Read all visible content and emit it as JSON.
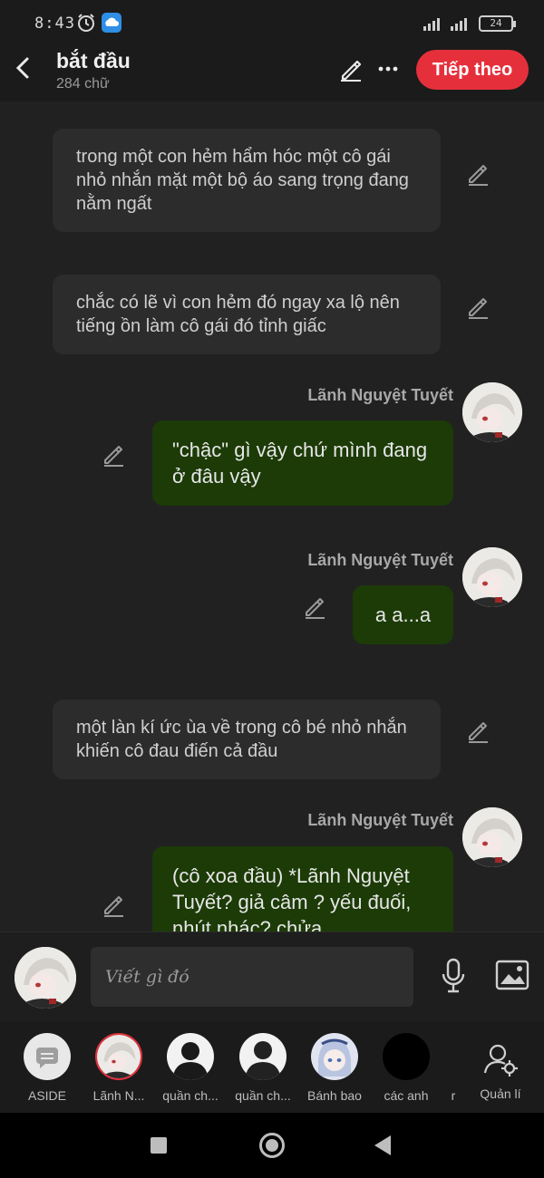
{
  "status": {
    "time": "8:43",
    "battery": "24"
  },
  "header": {
    "title": "bắt đầu",
    "subtitle": "284 chữ",
    "next_label": "Tiếp theo"
  },
  "messages": [
    {
      "type": "narration",
      "text": " trong một con hẻm hẩm hóc một cô gái nhỏ nhắn mặt một bộ áo sang trọng đang nằm ngất"
    },
    {
      "type": "narration",
      "text": "chắc có lẽ vì con hẻm đó ngay xa lộ nên tiếng ồn làm cô gái đó tỉnh giấc"
    },
    {
      "type": "speech",
      "speaker": "Lãnh Nguyệt Tuyết",
      "text": "\"chậc\" gì vậy chứ mình đang ở đâu vậy"
    },
    {
      "type": "speech",
      "speaker": "Lãnh Nguyệt Tuyết",
      "text": "a a...a"
    },
    {
      "type": "narration",
      "text": "một làn kí ức ùa về trong cô bé nhỏ nhắn khiến cô đau điến cả đầu"
    },
    {
      "type": "speech",
      "speaker": "Lãnh Nguyệt Tuyết",
      "text": "(cô xoa đầu) *Lãnh Nguyệt Tuyết? giả câm ? yếu đuối, nhút nhác? chửa"
    }
  ],
  "input": {
    "placeholder": "Viết gì đó"
  },
  "characters": [
    {
      "label": "ASIDE",
      "icon": "aside-icon"
    },
    {
      "label": "Lãnh N...",
      "icon": "avatar-anime"
    },
    {
      "label": "quần ch...",
      "icon": "silhouette-icon"
    },
    {
      "label": "quần ch...",
      "icon": "silhouette-icon"
    },
    {
      "label": "Bánh bao",
      "icon": "avatar-anime-blue"
    },
    {
      "label": "các anh",
      "icon": "black-circle"
    },
    {
      "label": "r",
      "icon": ""
    }
  ],
  "manage_label": "Quản lí",
  "colors": {
    "accent": "#e5303c",
    "speech_bubble": "#1c3b07",
    "narration_bubble": "#2c2c2c",
    "background": "#212121"
  }
}
